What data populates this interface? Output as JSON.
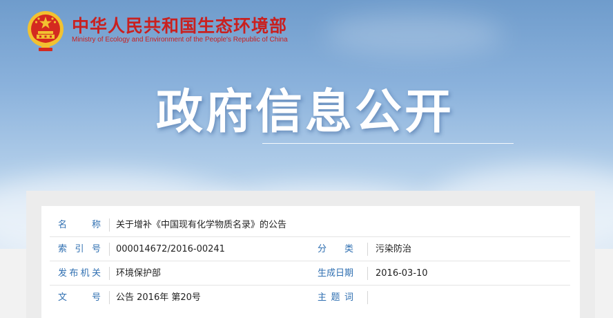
{
  "header": {
    "site_title_cn": "中华人民共和国生态环境部",
    "site_title_en": "Ministry of Ecology and Environment of the People's Republic of China",
    "emblem_icon": "national-emblem-icon"
  },
  "banner": {
    "title": "政府信息公开"
  },
  "info": {
    "rows": [
      {
        "label": "名 称",
        "value": "关于增补《中国现有化学物质名录》的公告"
      },
      {
        "label": "索引号",
        "value": "000014672/2016-00241",
        "label2": "分 类",
        "value2": "污染防治"
      },
      {
        "label": "发布机关",
        "value": "环境保护部",
        "label2": "生成日期",
        "value2": "2016-03-10"
      },
      {
        "label": "文 号",
        "value": "公告 2016年 第20号",
        "label2": "主题词",
        "value2": ""
      }
    ]
  },
  "colors": {
    "brand_red": "#c9201f",
    "label_blue": "#2f6fb1",
    "gold": "#f2c230"
  }
}
